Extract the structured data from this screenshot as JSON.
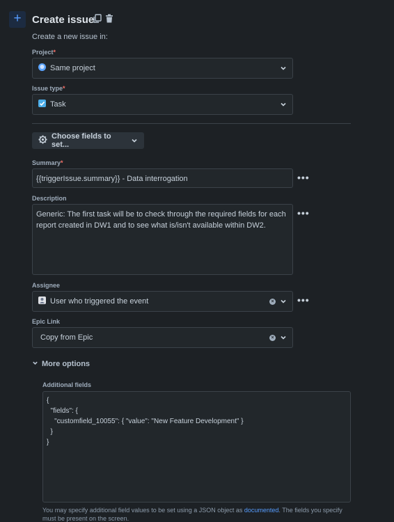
{
  "header": {
    "add_symbol": "+",
    "title": "Create issue",
    "subtitle": "Create a new issue in:"
  },
  "project": {
    "label": "Project",
    "required_mark": "*",
    "value": "Same project"
  },
  "issue_type": {
    "label": "Issue type",
    "required_mark": "*",
    "value": "Task"
  },
  "choose_fields": {
    "label": "Choose fields to set..."
  },
  "summary": {
    "label": "Summary",
    "required_mark": "*",
    "value": "{{triggerIssue.summary}} - Data interrogation"
  },
  "description": {
    "label": "Description",
    "value": "Generic: The first task will be to check through the required fields for each report created in DW1 and to see what is/isn't available within DW2."
  },
  "assignee": {
    "label": "Assignee",
    "value": "User who triggered the event"
  },
  "epic_link": {
    "label": "Epic Link",
    "value": "Copy from Epic"
  },
  "more_options": {
    "label": "More options"
  },
  "additional_fields": {
    "label": "Additional fields",
    "value": "{\n  \"fields\": {\n    \"customfield_10055\": { \"value\": \"New Feature Development\" }\n  }\n}",
    "helper_before": "You may specify additional field values to be set using a JSON object as ",
    "helper_link": "documented",
    "helper_after": ". The fields you specify must be present on the screen."
  },
  "colors": {
    "background": "#1d2125",
    "accent": "#579dff",
    "required": "#f87168"
  }
}
